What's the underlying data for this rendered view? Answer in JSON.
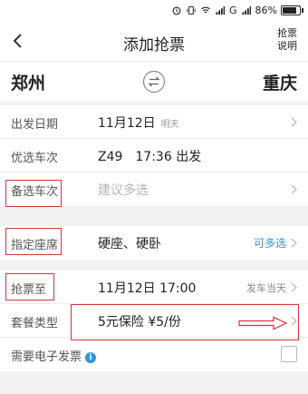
{
  "status_bar": {
    "signal": "G",
    "battery": "86%",
    "battery_level": 0.86
  },
  "nav": {
    "title": "添加抢票",
    "help_line1": "抢票",
    "help_line2": "说明"
  },
  "route": {
    "from": "郑州",
    "to": "重庆"
  },
  "rows": {
    "date": {
      "label": "出发日期",
      "value": "11月12日",
      "sub": "明天"
    },
    "train": {
      "label": "优选车次",
      "value": "Z49　17:36 出发"
    },
    "alt_train": {
      "label": "备选车次",
      "placeholder": "建议多选"
    },
    "seat": {
      "label": "指定座席",
      "value": "硬座、硬卧",
      "action": "可多选"
    },
    "until": {
      "label": "抢票至",
      "value": "11月12日 17:00",
      "right": "发车当天"
    },
    "package": {
      "label": "套餐类型",
      "value": "5元保险 ¥5/份"
    },
    "invoice": {
      "label": "需要电子发票",
      "info_icon": "i"
    }
  },
  "colors": {
    "accent": "#2e9ad8",
    "annotation": "#d9343a"
  }
}
